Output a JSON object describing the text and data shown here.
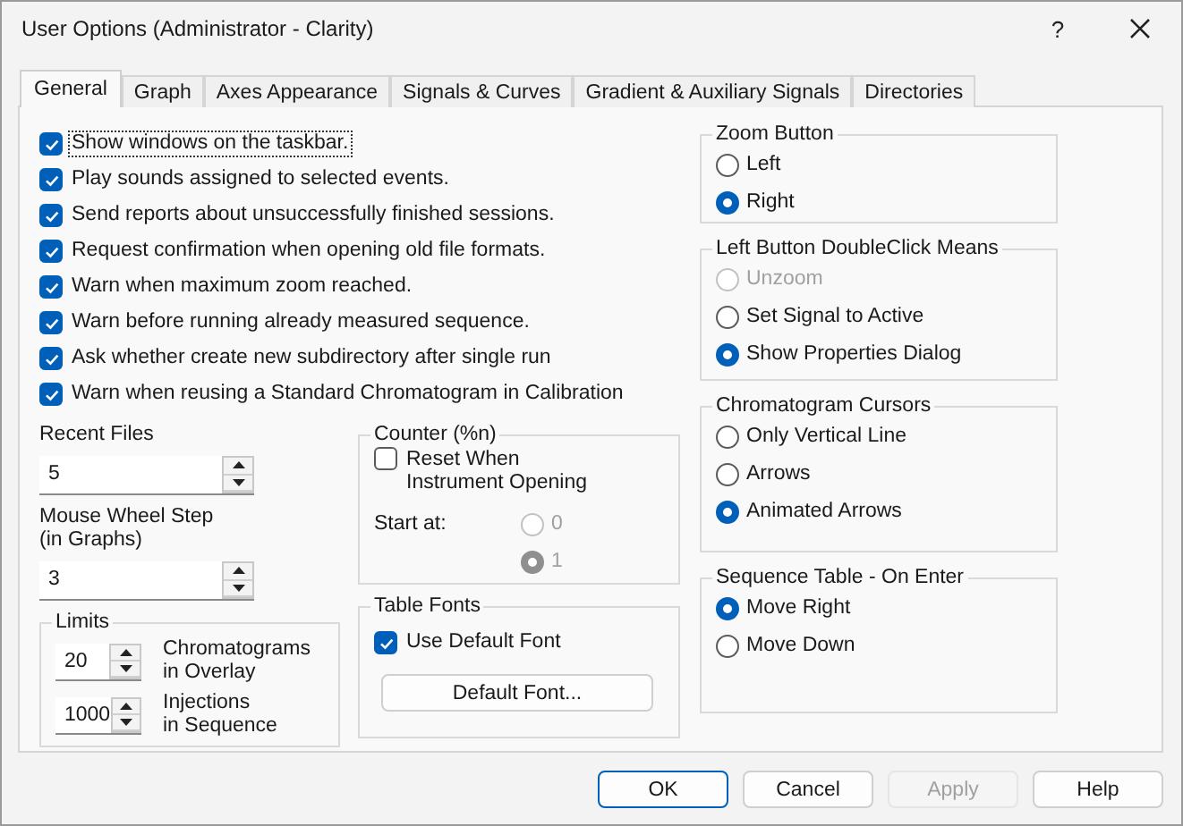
{
  "window": {
    "title": "User Options (Administrator - Clarity)",
    "help": "?"
  },
  "tabs": [
    {
      "label": "General",
      "selected": true
    },
    {
      "label": "Graph",
      "selected": false
    },
    {
      "label": "Axes Appearance",
      "selected": false
    },
    {
      "label": "Signals & Curves",
      "selected": false
    },
    {
      "label": "Gradient & Auxiliary Signals",
      "selected": false
    },
    {
      "label": "Directories",
      "selected": false
    }
  ],
  "options": [
    {
      "label": "Show windows on the taskbar.",
      "checked": true,
      "focused": true
    },
    {
      "label": "Play sounds assigned to selected events.",
      "checked": true,
      "focused": false
    },
    {
      "label": "Send reports about unsuccessfully finished sessions.",
      "checked": true,
      "focused": false
    },
    {
      "label": "Request confirmation when opening old file formats.",
      "checked": true,
      "focused": false
    },
    {
      "label": "Warn when maximum zoom reached.",
      "checked": true,
      "focused": false
    },
    {
      "label": "Warn before running already measured sequence.",
      "checked": true,
      "focused": false
    },
    {
      "label": "Ask whether create new subdirectory after single run",
      "checked": true,
      "focused": false
    },
    {
      "label": "Warn when reusing a Standard Chromatogram in Calibration",
      "checked": true,
      "focused": false
    }
  ],
  "recent_files": {
    "label": "Recent Files",
    "value": "5"
  },
  "mouse_wheel_step": {
    "label": "Mouse Wheel Step\n(in Graphs)",
    "value": "3"
  },
  "limits": {
    "title": "Limits",
    "items": [
      {
        "value": "20",
        "label": "Chromatograms\nin Overlay"
      },
      {
        "value": "1000",
        "label": "Injections\nin Sequence"
      }
    ]
  },
  "counter": {
    "title": "Counter (%n)",
    "reset": {
      "label": "Reset When\nInstrument Opening",
      "checked": false
    },
    "start_label": "Start at:",
    "options": [
      {
        "label": "0",
        "selected": false,
        "disabled": true
      },
      {
        "label": "1",
        "selected": true,
        "disabled": true
      }
    ]
  },
  "table_fonts": {
    "title": "Table Fonts",
    "use_default": {
      "label": "Use Default Font",
      "checked": true
    },
    "button": "Default Font..."
  },
  "radio_groups": [
    {
      "title": "Zoom Button",
      "options": [
        {
          "label": "Left",
          "selected": false,
          "disabled": false
        },
        {
          "label": "Right",
          "selected": true,
          "disabled": false
        }
      ]
    },
    {
      "title": "Left Button DoubleClick Means",
      "options": [
        {
          "label": "Unzoom",
          "selected": false,
          "disabled": true
        },
        {
          "label": "Set Signal to Active",
          "selected": false,
          "disabled": false
        },
        {
          "label": "Show Properties Dialog",
          "selected": true,
          "disabled": false
        }
      ]
    },
    {
      "title": "Chromatogram Cursors",
      "options": [
        {
          "label": "Only Vertical Line",
          "selected": false,
          "disabled": false
        },
        {
          "label": "Arrows",
          "selected": false,
          "disabled": false
        },
        {
          "label": "Animated Arrows",
          "selected": true,
          "disabled": false
        }
      ]
    },
    {
      "title": "Sequence Table - On Enter",
      "options": [
        {
          "label": "Move Right",
          "selected": true,
          "disabled": false
        },
        {
          "label": "Move Down",
          "selected": false,
          "disabled": false
        }
      ]
    }
  ],
  "buttons": [
    {
      "label": "OK",
      "disabled": false,
      "default": true
    },
    {
      "label": "Cancel",
      "disabled": false,
      "default": false
    },
    {
      "label": "Apply",
      "disabled": true,
      "default": false
    },
    {
      "label": "Help",
      "disabled": false,
      "default": false
    }
  ]
}
